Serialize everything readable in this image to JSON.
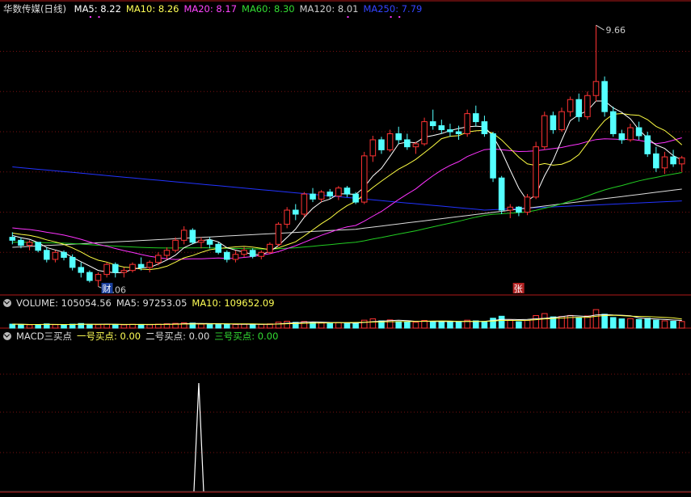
{
  "price_panel": {
    "title": "华数传媒(日线)",
    "ma_labels": [
      {
        "text": "MA5: 8.22",
        "color": "#ffffff"
      },
      {
        "text": "MA10: 8.26",
        "color": "#ffff55"
      },
      {
        "text": "MA20: 8.17",
        "color": "#ff44ff"
      },
      {
        "text": "MA60: 8.30",
        "color": "#33dd33"
      },
      {
        "text": "MA120: 8.01",
        "color": "#cccccc"
      },
      {
        "text": "MA250: 7.79",
        "color": "#3344ff"
      }
    ],
    "high_marker": "9.66",
    "low_marker": "7.06",
    "tag_left": "财",
    "tag_right": "张"
  },
  "volume_panel": {
    "labels": [
      {
        "text": "VOLUME: 105054.56",
        "color": "#dddddd"
      },
      {
        "text": "MA5: 97253.05",
        "color": "#dddddd"
      },
      {
        "text": "MA10: 109652.09",
        "color": "#ffff55"
      }
    ]
  },
  "macd_panel": {
    "labels": [
      {
        "text": "MACD三买点",
        "color": "#dddddd"
      },
      {
        "text": "一号买点: 0.00",
        "color": "#ffff55"
      },
      {
        "text": "二号买点: 0.00",
        "color": "#dddddd"
      },
      {
        "text": "三号买点: 0.00",
        "color": "#33dd33"
      }
    ]
  },
  "colors": {
    "up": "#ff3333",
    "down": "#54ffff",
    "ma250": "#2233ff",
    "ma120": "#dddddd",
    "ma60": "#22cc22",
    "ma20": "#ff33ff",
    "ma10": "#ffff44",
    "ma5": "#ffffff",
    "grid": "#7a1010"
  },
  "chart_data": {
    "type": "candlestick",
    "title": "华数传媒(日线)",
    "x_axis": "trading days",
    "ohlc": [
      [
        7.55,
        7.6,
        7.48,
        7.52
      ],
      [
        7.52,
        7.55,
        7.44,
        7.47
      ],
      [
        7.47,
        7.52,
        7.42,
        7.5
      ],
      [
        7.5,
        7.5,
        7.4,
        7.42
      ],
      [
        7.42,
        7.45,
        7.3,
        7.33
      ],
      [
        7.33,
        7.42,
        7.3,
        7.4
      ],
      [
        7.4,
        7.42,
        7.32,
        7.35
      ],
      [
        7.35,
        7.38,
        7.22,
        7.25
      ],
      [
        7.25,
        7.3,
        7.15,
        7.2
      ],
      [
        7.2,
        7.22,
        7.1,
        7.12
      ],
      [
        7.12,
        7.2,
        7.06,
        7.18
      ],
      [
        7.18,
        7.3,
        7.15,
        7.28
      ],
      [
        7.28,
        7.3,
        7.15,
        7.2
      ],
      [
        7.2,
        7.25,
        7.15,
        7.22
      ],
      [
        7.22,
        7.3,
        7.2,
        7.28
      ],
      [
        7.28,
        7.35,
        7.22,
        7.25
      ],
      [
        7.25,
        7.32,
        7.2,
        7.3
      ],
      [
        7.3,
        7.4,
        7.27,
        7.37
      ],
      [
        7.37,
        7.45,
        7.33,
        7.42
      ],
      [
        7.42,
        7.55,
        7.4,
        7.52
      ],
      [
        7.52,
        7.66,
        7.48,
        7.62
      ],
      [
        7.62,
        7.64,
        7.48,
        7.5
      ],
      [
        7.5,
        7.55,
        7.44,
        7.52
      ],
      [
        7.52,
        7.55,
        7.44,
        7.48
      ],
      [
        7.48,
        7.5,
        7.38,
        7.4
      ],
      [
        7.4,
        7.42,
        7.3,
        7.33
      ],
      [
        7.33,
        7.42,
        7.3,
        7.38
      ],
      [
        7.38,
        7.45,
        7.35,
        7.42
      ],
      [
        7.42,
        7.44,
        7.34,
        7.36
      ],
      [
        7.36,
        7.42,
        7.33,
        7.4
      ],
      [
        7.4,
        7.5,
        7.38,
        7.48
      ],
      [
        7.48,
        7.7,
        7.46,
        7.68
      ],
      [
        7.68,
        7.85,
        7.64,
        7.82
      ],
      [
        7.82,
        7.88,
        7.72,
        7.78
      ],
      [
        7.78,
        8.0,
        7.75,
        7.98
      ],
      [
        7.98,
        8.04,
        7.9,
        7.93
      ],
      [
        7.93,
        8.02,
        7.9,
        8.0
      ],
      [
        8.0,
        8.03,
        7.93,
        7.96
      ],
      [
        7.96,
        8.06,
        7.92,
        8.04
      ],
      [
        8.04,
        8.06,
        7.95,
        7.98
      ],
      [
        7.98,
        8.0,
        7.88,
        7.9
      ],
      [
        7.9,
        8.4,
        7.88,
        8.36
      ],
      [
        8.36,
        8.56,
        8.3,
        8.52
      ],
      [
        8.52,
        8.55,
        8.38,
        8.42
      ],
      [
        8.42,
        8.62,
        8.4,
        8.58
      ],
      [
        8.58,
        8.65,
        8.48,
        8.52
      ],
      [
        8.52,
        8.58,
        8.42,
        8.45
      ],
      [
        8.45,
        8.5,
        8.38,
        8.48
      ],
      [
        8.48,
        8.74,
        8.46,
        8.7
      ],
      [
        8.7,
        8.82,
        8.62,
        8.66
      ],
      [
        8.66,
        8.72,
        8.58,
        8.62
      ],
      [
        8.62,
        8.68,
        8.55,
        8.6
      ],
      [
        8.6,
        8.66,
        8.52,
        8.58
      ],
      [
        8.58,
        8.82,
        8.55,
        8.78
      ],
      [
        8.78,
        8.86,
        8.65,
        8.7
      ],
      [
        8.7,
        8.76,
        8.55,
        8.58
      ],
      [
        8.58,
        8.6,
        8.1,
        8.14
      ],
      [
        8.14,
        8.16,
        7.78,
        7.82
      ],
      [
        7.82,
        7.88,
        7.74,
        7.85
      ],
      [
        7.85,
        7.86,
        7.76,
        7.8
      ],
      [
        7.8,
        7.98,
        7.77,
        7.95
      ],
      [
        7.95,
        8.5,
        7.93,
        8.45
      ],
      [
        8.45,
        8.8,
        8.42,
        8.76
      ],
      [
        8.76,
        8.8,
        8.58,
        8.62
      ],
      [
        8.62,
        8.84,
        8.6,
        8.8
      ],
      [
        8.8,
        8.95,
        8.75,
        8.92
      ],
      [
        8.92,
        8.98,
        8.7,
        8.75
      ],
      [
        8.75,
        9.0,
        8.72,
        8.96
      ],
      [
        8.96,
        9.66,
        8.9,
        9.1
      ],
      [
        9.1,
        9.15,
        8.75,
        8.8
      ],
      [
        8.8,
        8.85,
        8.55,
        8.58
      ],
      [
        8.58,
        8.62,
        8.48,
        8.52
      ],
      [
        8.52,
        8.68,
        8.5,
        8.64
      ],
      [
        8.64,
        8.7,
        8.52,
        8.56
      ],
      [
        8.56,
        8.6,
        8.35,
        8.38
      ],
      [
        8.38,
        8.45,
        8.2,
        8.24
      ],
      [
        8.24,
        8.4,
        8.18,
        8.35
      ],
      [
        8.35,
        8.42,
        8.25,
        8.28
      ],
      [
        8.28,
        8.36,
        8.2,
        8.34
      ]
    ],
    "volume": [
      30,
      28,
      25,
      27,
      32,
      26,
      24,
      30,
      35,
      28,
      26,
      30,
      27,
      25,
      29,
      28,
      26,
      30,
      33,
      36,
      40,
      38,
      30,
      28,
      32,
      30,
      27,
      29,
      26,
      28,
      32,
      45,
      52,
      44,
      50,
      42,
      40,
      38,
      41,
      39,
      36,
      60,
      70,
      55,
      62,
      50,
      46,
      44,
      58,
      52,
      48,
      45,
      47,
      60,
      55,
      50,
      75,
      90,
      60,
      48,
      58,
      95,
      110,
      85,
      88,
      96,
      80,
      92,
      140,
      105,
      80,
      70,
      72,
      66,
      74,
      60,
      55,
      52,
      50
    ],
    "macd_signal": {
      "peak_day_index": 22,
      "peak_value": 1
    }
  }
}
